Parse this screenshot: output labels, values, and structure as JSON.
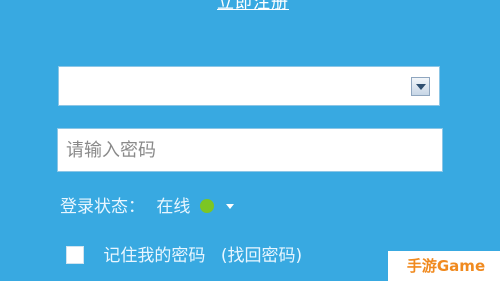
{
  "header": {
    "register_link": "立即注册"
  },
  "account_field": {
    "value": "",
    "icon": "chevron-down-icon"
  },
  "password_field": {
    "placeholder": "请输入密码",
    "value": ""
  },
  "status": {
    "label": "登录状态：",
    "value": "在线",
    "indicator_color": "#7cc623"
  },
  "remember": {
    "label": "记住我的密码",
    "find_password": "(找回密码)",
    "checked": false
  },
  "watermark": {
    "text": "手游Game"
  },
  "colors": {
    "background": "#38a9e1",
    "watermark_text": "#f08a1f"
  }
}
